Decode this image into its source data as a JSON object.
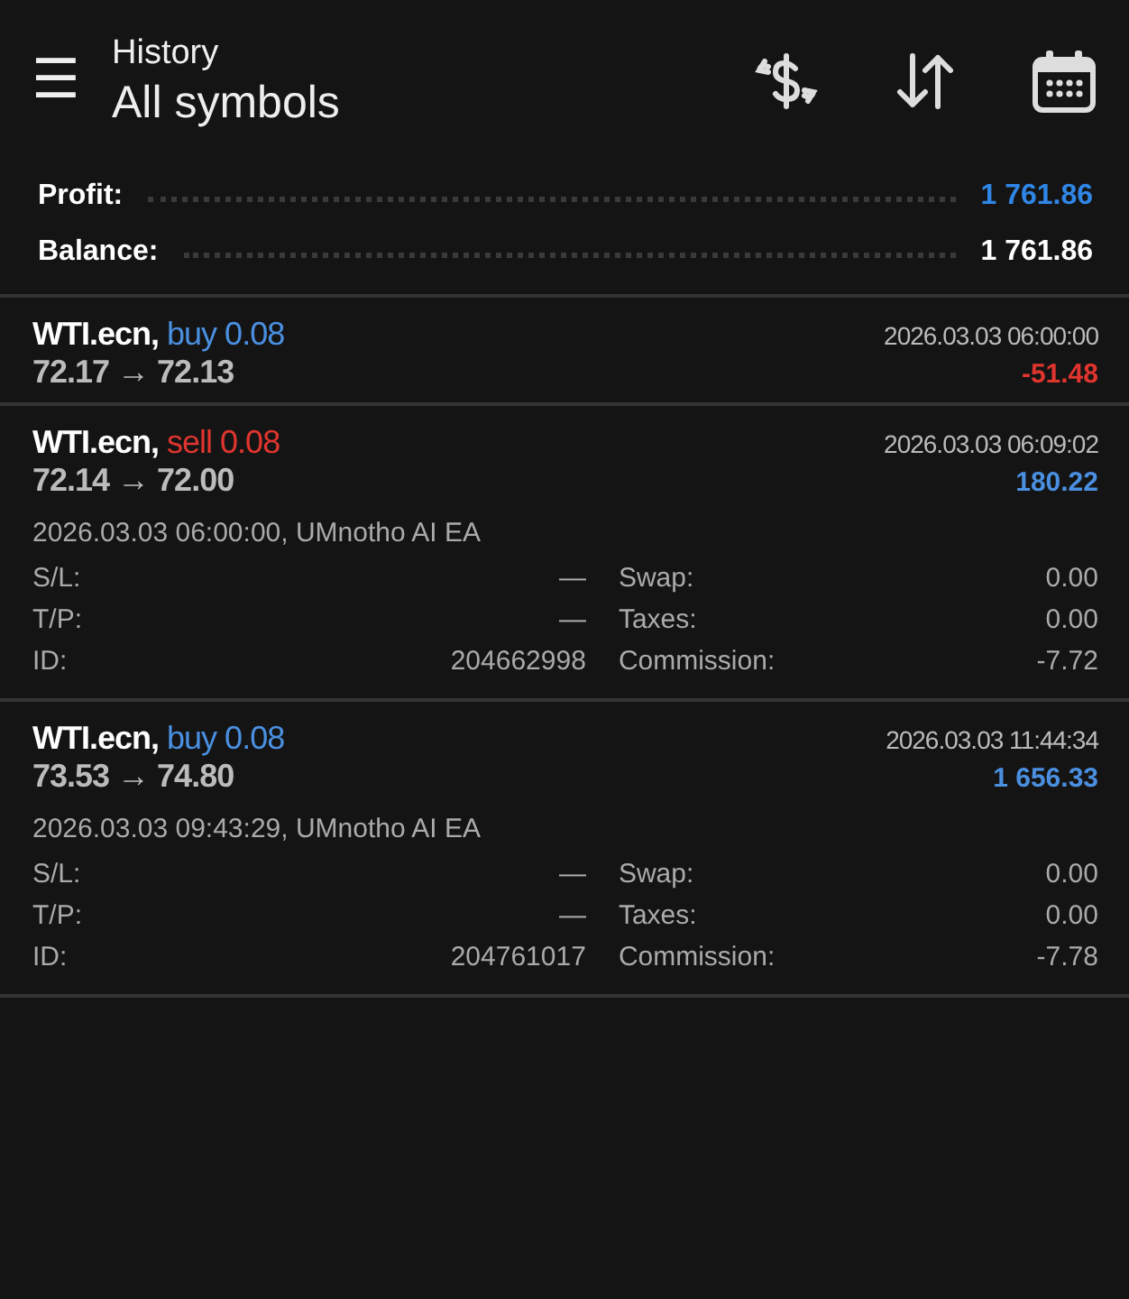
{
  "header": {
    "menu_glyph": "☰",
    "title": "History",
    "subtitle": "All symbols"
  },
  "summary": [
    {
      "label": "Profit:",
      "value": "1 761.86",
      "highlight": true
    },
    {
      "label": "Balance:",
      "value": "1 761.86",
      "highlight": false
    }
  ],
  "deals": [
    {
      "symbol": "WTI.ecn,",
      "kind": "buy",
      "order": "buy 0.08",
      "prices": "72.17 → 72.13",
      "time": "2026.03.03 06:00:00",
      "profit": "-51.48",
      "loss": true,
      "expanded": false
    },
    {
      "symbol": "WTI.ecn,",
      "kind": "sell",
      "order": "sell 0.08",
      "prices": "72.14 → 72.00",
      "time": "2026.03.03 06:09:02",
      "profit": "180.22",
      "loss": false,
      "expanded": true,
      "opened": "2026.03.03 06:00:00, UMnotho AI EA",
      "left": [
        {
          "label": "S/L:",
          "value": "—"
        },
        {
          "label": "T/P:",
          "value": "—"
        },
        {
          "label": "ID:",
          "value": "204662998"
        }
      ],
      "right": [
        {
          "label": "Swap:",
          "value": "0.00"
        },
        {
          "label": "Taxes:",
          "value": "0.00"
        },
        {
          "label": "Commission:",
          "value": "-7.72"
        }
      ]
    },
    {
      "symbol": "WTI.ecn,",
      "kind": "buy",
      "order": "buy 0.08",
      "prices": "73.53 → 74.80",
      "time": "2026.03.03 11:44:34",
      "profit": "1 656.33",
      "loss": false,
      "expanded": true,
      "opened": "2026.03.03 09:43:29, UMnotho AI EA",
      "left": [
        {
          "label": "S/L:",
          "value": "—"
        },
        {
          "label": "T/P:",
          "value": "—"
        },
        {
          "label": "ID:",
          "value": "204761017"
        }
      ],
      "right": [
        {
          "label": "Swap:",
          "value": "0.00"
        },
        {
          "label": "Taxes:",
          "value": "0.00"
        },
        {
          "label": "Commission:",
          "value": "-7.78"
        }
      ]
    }
  ]
}
